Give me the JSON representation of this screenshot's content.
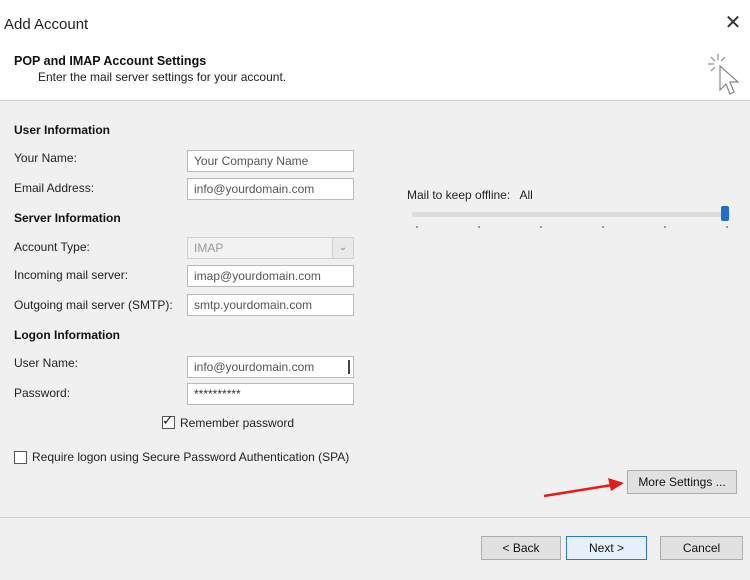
{
  "window": {
    "title": "Add Account",
    "close_glyph": "✕"
  },
  "header": {
    "title": "POP and IMAP Account Settings",
    "subtitle": "Enter the mail server settings for your account."
  },
  "user_info": {
    "heading": "User Information",
    "name_label": "Your Name:",
    "name_value": "Your Company Name",
    "email_label": "Email Address:",
    "email_value": "info@yourdomain.com"
  },
  "server_info": {
    "heading": "Server Information",
    "type_label": "Account Type:",
    "type_value": "IMAP",
    "incoming_label": "Incoming mail server:",
    "incoming_value": "imap@yourdomain.com",
    "outgoing_label": "Outgoing mail server (SMTP):",
    "outgoing_value": "smtp.yourdomain.com"
  },
  "logon_info": {
    "heading": "Logon Information",
    "username_label": "User Name:",
    "username_value": "info@yourdomain.com",
    "password_label": "Password:",
    "password_value": "**********",
    "remember_label": "Remember password",
    "remember_checked": true,
    "spa_label": "Require logon using Secure Password Authentication (SPA)",
    "spa_checked": false
  },
  "offline": {
    "label": "Mail to keep offline:",
    "value": "All",
    "level": 1.0
  },
  "buttons": {
    "more_settings": "More Settings ...",
    "back": "< Back",
    "next": "Next >",
    "cancel": "Cancel"
  },
  "icons": {
    "close": "close-icon",
    "dropdown": "chevron-down-icon",
    "cursor": "cursor-icon",
    "arrow": "red-arrow-icon"
  },
  "colors": {
    "accent": "#1f6fd1",
    "arrow": "#e21b1b"
  }
}
